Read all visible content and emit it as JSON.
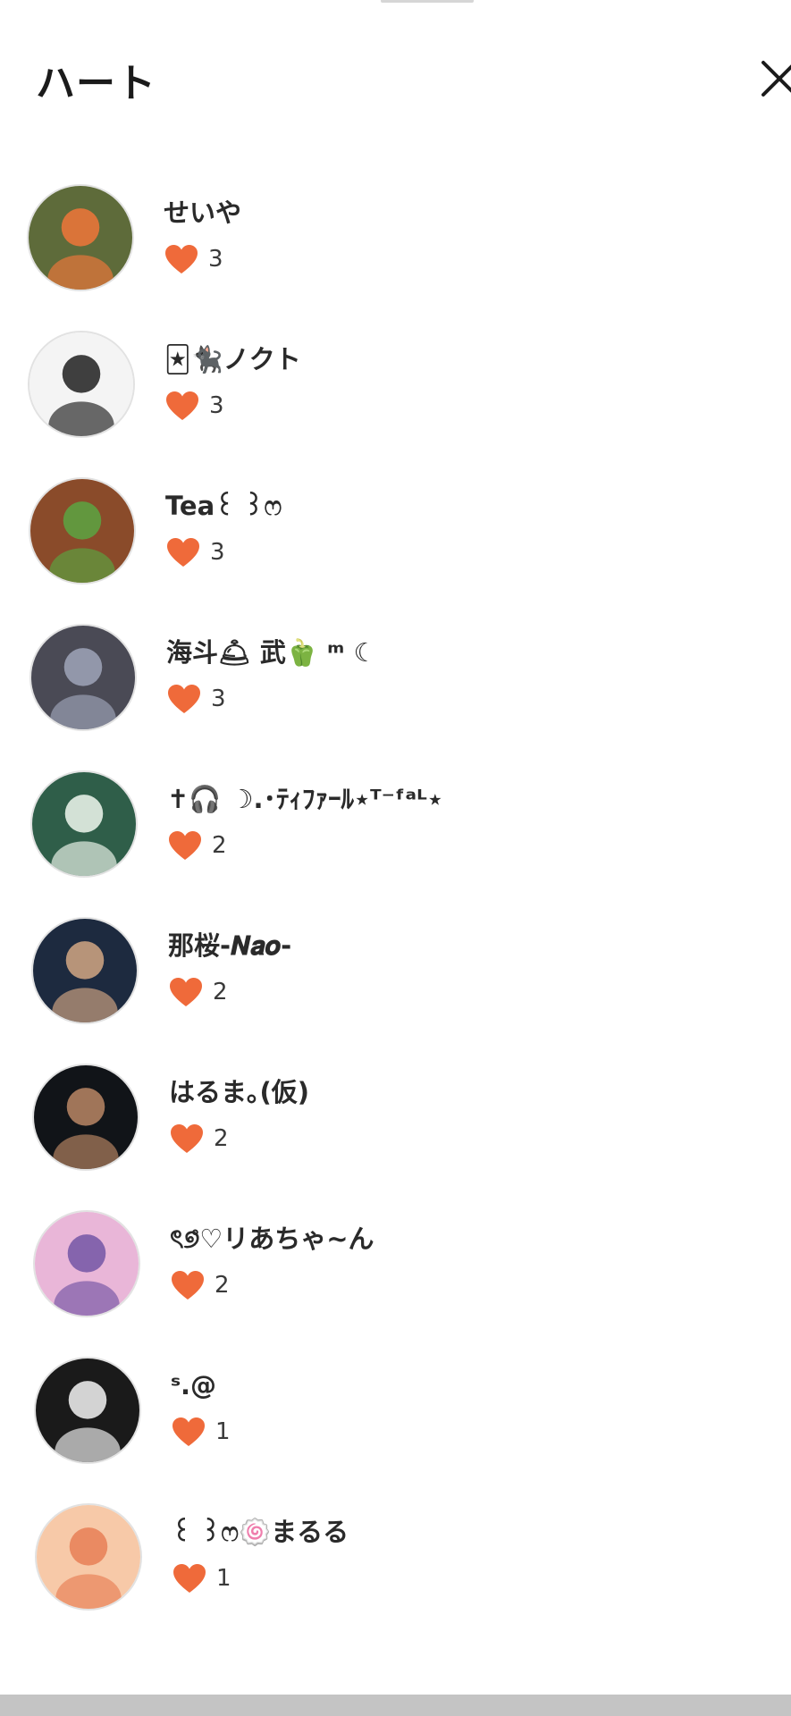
{
  "sheet": {
    "title": "ハート",
    "close_icon": "close-icon"
  },
  "heart_color": "#ef6a3a",
  "users": [
    {
      "name": "せいや",
      "likes": "3",
      "avatar": "illustrated-boy-on-bicycle",
      "avatar_bg": "#5e6b3a",
      "avatar_fg": "#e8763a"
    },
    {
      "name": "🃏🐈‍⬛ノクト",
      "likes": "3",
      "avatar": "anime-boy-with-glasses",
      "avatar_bg": "#f4f4f4",
      "avatar_fg": "#2b2b2b"
    },
    {
      "name": "Tea꒰ ꒱ෆ",
      "likes": "3",
      "avatar": "food-plate-photo",
      "avatar_bg": "#8a4b2a",
      "avatar_fg": "#5da040"
    },
    {
      "name": "海斗🛎 武🫑 ᵐ ☾",
      "likes": "3",
      "avatar": "room-photo",
      "avatar_bg": "#4a4a55",
      "avatar_fg": "#9aa0b4"
    },
    {
      "name": "✝︎🎧 ☽.･ﾃｨﾌｧｰﾙ⋆ᵀ⁻ᶠᵃᴸ⋆",
      "likes": "2",
      "avatar": "tefal-chalkboard",
      "avatar_bg": "#2f5e49",
      "avatar_fg": "#e6efe6"
    },
    {
      "name": "那桜-𝑵𝒂𝒐-",
      "likes": "2",
      "avatar": "anime-man-night",
      "avatar_bg": "#1d2a3f",
      "avatar_fg": "#c9a080"
    },
    {
      "name": "はるま｡(仮)",
      "likes": "2",
      "avatar": "couple-photo",
      "avatar_bg": "#111418",
      "avatar_fg": "#b08060"
    },
    {
      "name": "ৎ୭̊♡リあちゃ~ん",
      "likes": "2",
      "avatar": "anime-girl-purple",
      "avatar_bg": "#e9b6d8",
      "avatar_fg": "#7a5ba8"
    },
    {
      "name": "ˢ.@",
      "likes": "1",
      "avatar": "monochrome-photo",
      "avatar_bg": "#1a1a1a",
      "avatar_fg": "#e8e8e8"
    },
    {
      "name": "꒰ ꒱ෆ🍥まるる",
      "likes": "1",
      "avatar": "hooded-character",
      "avatar_bg": "#f7c9a8",
      "avatar_fg": "#e8835a"
    }
  ]
}
